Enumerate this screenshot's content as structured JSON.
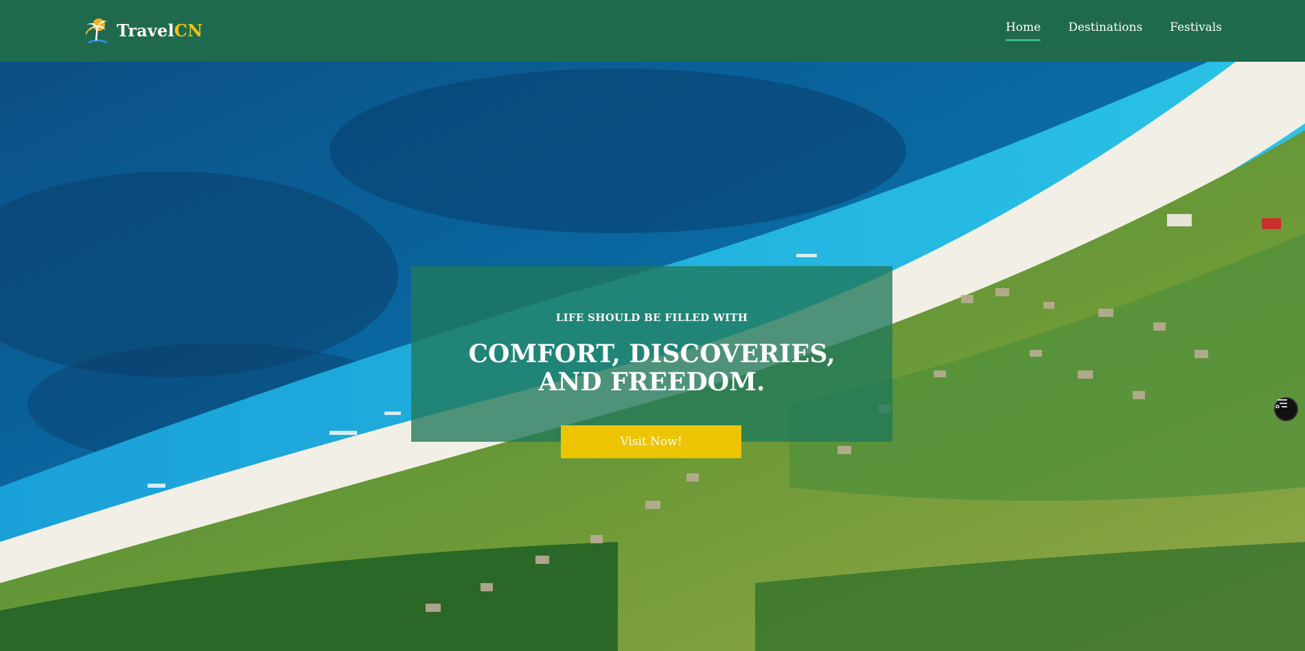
{
  "logo": {
    "brand_main": "Travel",
    "brand_accent": "CN"
  },
  "nav": [
    {
      "label": "Home",
      "active": true
    },
    {
      "label": "Destinations",
      "active": false
    },
    {
      "label": "Festivals",
      "active": false
    }
  ],
  "hero": {
    "kicker": "LIFE SHOULD BE FILLED WITH",
    "title": "COMFORT, DISCOVERIES, AND FREEDOM.",
    "cta_label": "Visit Now!"
  },
  "side_widget": {
    "icon": "filter-settings-icon"
  },
  "colors": {
    "header_bg": "#1f6a4d",
    "accent_yellow": "#f1c40f",
    "cta_yellow": "#ecc500",
    "active_underline": "#3fb58c"
  }
}
